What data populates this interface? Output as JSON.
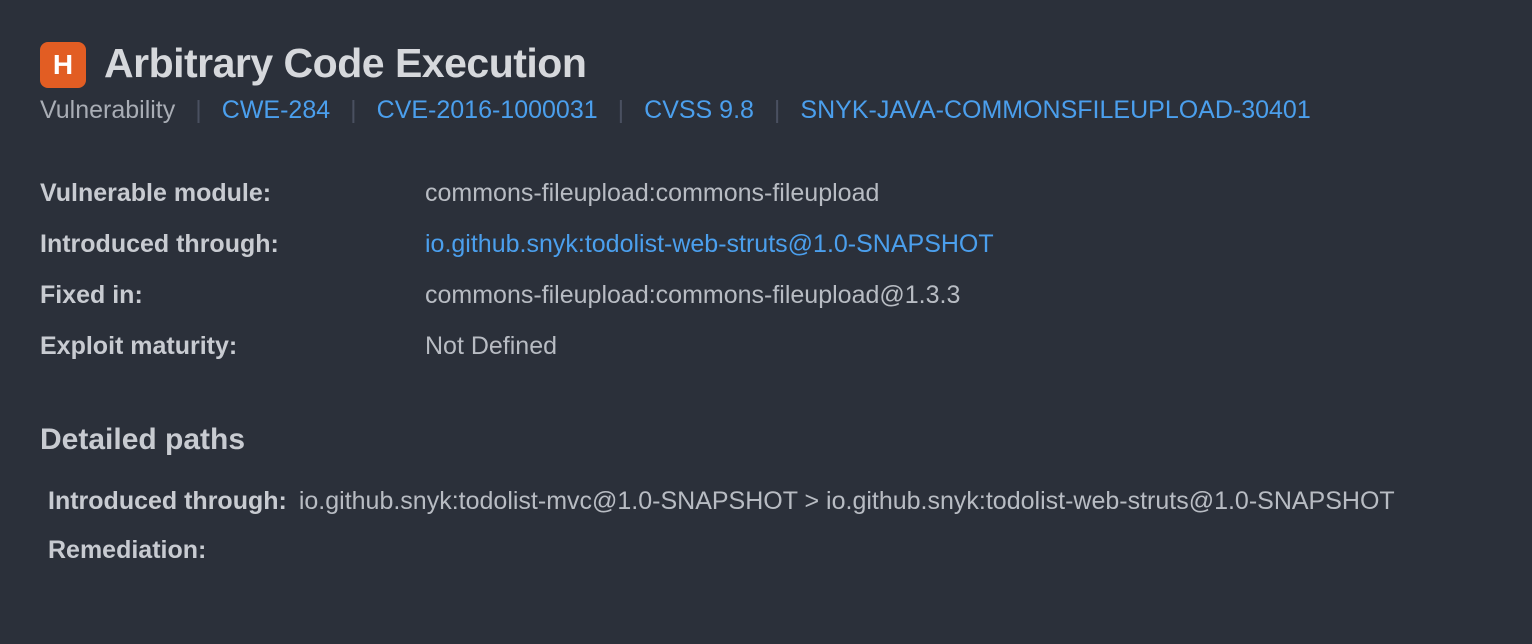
{
  "severity_letter": "H",
  "title": "Arbitrary Code Execution",
  "meta": {
    "type_label": "Vulnerability",
    "cwe": "CWE-284",
    "cve": "CVE-2016-1000031",
    "cvss": "CVSS 9.8",
    "snyk_id": "SNYK-JAVA-COMMONSFILEUPLOAD-30401"
  },
  "details": {
    "vulnerable_module": {
      "label": "Vulnerable module:",
      "value": "commons-fileupload:commons-fileupload"
    },
    "introduced_through": {
      "label": "Introduced through:",
      "value": "io.github.snyk:todolist-web-struts@1.0-SNAPSHOT"
    },
    "fixed_in": {
      "label": "Fixed in:",
      "value": "commons-fileupload:commons-fileupload@1.3.3"
    },
    "exploit_maturity": {
      "label": "Exploit maturity:",
      "value": "Not Defined"
    }
  },
  "section_heading": "Detailed paths",
  "paths": {
    "introduced_label": "Introduced through:",
    "introduced_value": "io.github.snyk:todolist-mvc@1.0-SNAPSHOT > io.github.snyk:todolist-web-struts@1.0-SNAPSHOT",
    "remediation_label": "Remediation:",
    "remediation_value": ""
  }
}
